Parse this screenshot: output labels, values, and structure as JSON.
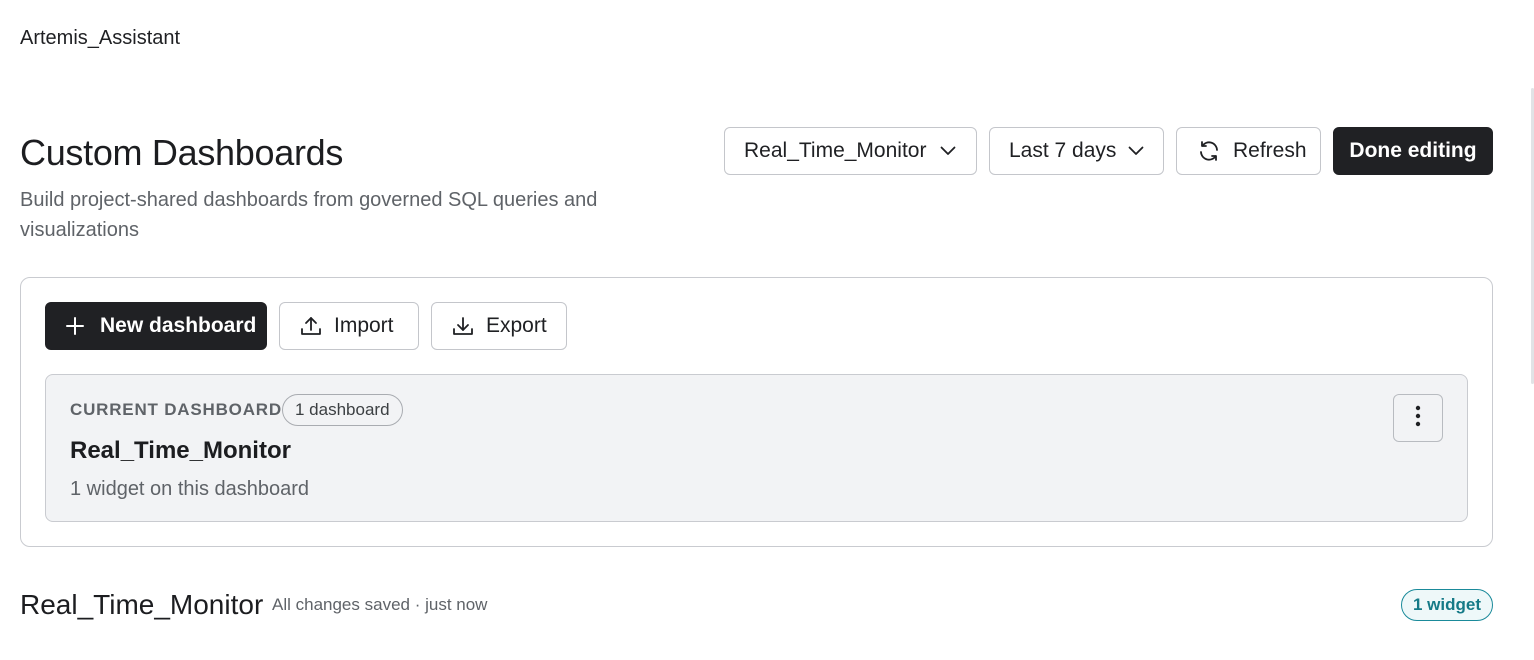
{
  "app": {
    "name": "Artemis_Assistant"
  },
  "header": {
    "title": "Custom Dashboards",
    "subtitle": "Build project-shared dashboards from governed SQL queries and visualizations"
  },
  "toolbar": {
    "dashboard_select": {
      "value": "Real_Time_Monitor",
      "icon": "chevron-down-icon"
    },
    "range_select": {
      "value": "Last 7 days",
      "icon": "chevron-down-icon"
    },
    "refresh_label": "Refresh",
    "done_label": "Done editing"
  },
  "panel": {
    "new_dashboard_label": "New dashboard",
    "import_label": "Import",
    "export_label": "Export",
    "current": {
      "eyebrow": "CURRENT DASHBOARD",
      "count_badge": "1 dashboard",
      "name": "Real_Time_Monitor",
      "description": "1 widget on this dashboard"
    }
  },
  "section": {
    "title": "Real_Time_Monitor",
    "status": "All changes saved · just now",
    "widget_count": "1 widget"
  },
  "colors": {
    "dark_button": "#202124",
    "border": "#c9cbd0",
    "card_bg": "#f2f3f5",
    "accent_teal": "#157a87"
  }
}
